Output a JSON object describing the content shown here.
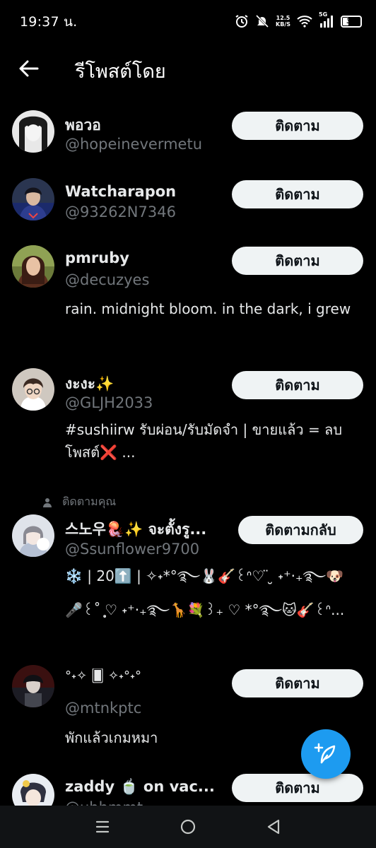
{
  "status_bar": {
    "time": "19:37 น.",
    "net_speed_value": "12.5",
    "net_speed_unit": "KB/S",
    "network": "5G",
    "battery": "30"
  },
  "header": {
    "title": "รีโพสต์โดย"
  },
  "users": [
    {
      "name": "พอวอ",
      "handle": "@hopeinevermetu",
      "button": "ติดตาม"
    },
    {
      "name": "Watcharapon",
      "handle": "@93262N7346",
      "button": "ติดตาม"
    },
    {
      "name": "pmruby",
      "handle": "@decuzyes",
      "bio": "rain. midnight bloom. in the dark, i grew",
      "button": "ติดตาม"
    },
    {
      "name": "งะงะ✨",
      "handle": "@GLJH2033",
      "bio": "#sushiirw  รับผ่อน/รับมัดจำ | ขายแล้ว = ลบโพสต์❌   ...",
      "button": "ติดตาม"
    },
    {
      "follows_you": "ติดตามคุณ",
      "name": "스노우🪼✨ จะตั้งรู...",
      "handle": "@Ssunflower9700",
      "bio_line1": "❄️ | 20⬆️ | ✧˖*°࿐🐰🎸꒰ᐢ♡ ̈ ̮ ˖⁺‧₊࿐🐶",
      "bio_line2": "🎤꒰˚ ̥͙♡ ˖⁺‧₊࿐🦒💐꒱₊ ♡ *°࿐🐱🎸꒰ᐢ...",
      "button": "ติดตามกลับ"
    },
    {
      "name": "°˖✧ 🂠 ✧˖°˖°",
      "handle": "@mtnkptc",
      "bio": "พักแล้วเกมหมา",
      "button": "ติดตาม"
    },
    {
      "name": "zaddy 🍵 on vac...",
      "handle": "@uhhmmt",
      "button": "ติดตาม"
    }
  ],
  "colors": {
    "background": "#000000",
    "accent": "#1d9bf0",
    "secondary_text": "#71767b",
    "button_bg": "#eff3f4"
  },
  "icons": {
    "back": "arrow-left-icon",
    "fab": "compose-feather-icon",
    "nav": [
      "recents-icon",
      "home-icon",
      "back-triangle-icon"
    ]
  }
}
